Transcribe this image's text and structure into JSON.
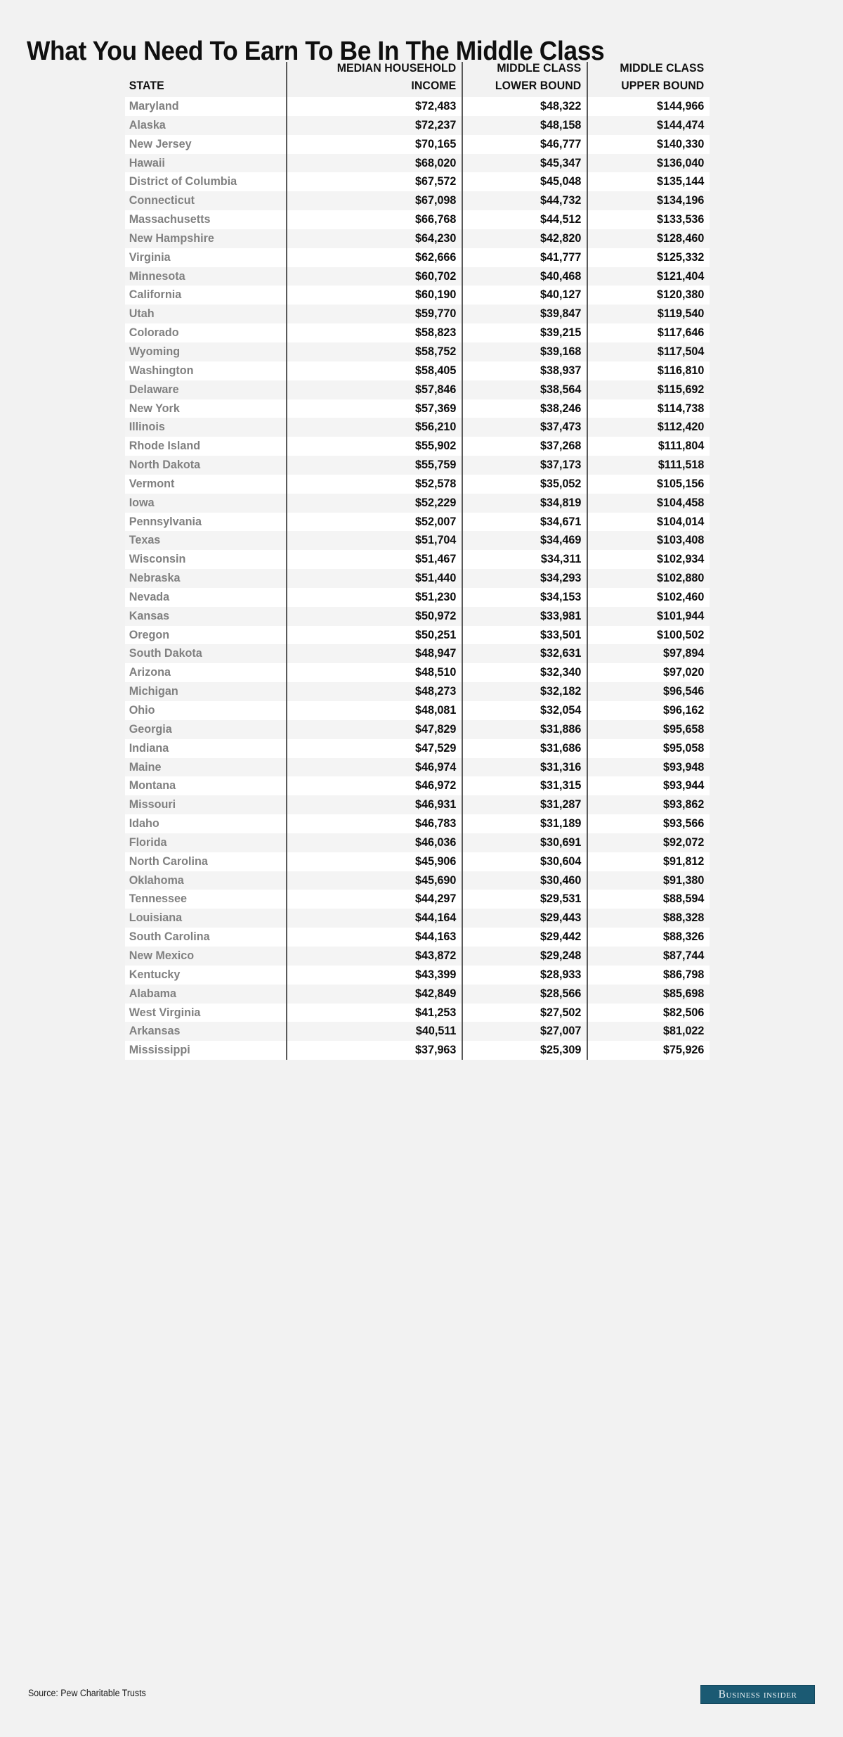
{
  "title": "What You Need To Earn To Be In The Middle Class",
  "table": {
    "headers": {
      "state": "STATE",
      "median_household_income_line1": "MEDIAN HOUSEHOLD",
      "median_household_income_line2": "INCOME",
      "middle_class_lower_line1": "MIDDLE CLASS",
      "middle_class_lower_line2": "LOWER BOUND",
      "middle_class_upper_line1": "MIDDLE CLASS",
      "middle_class_upper_line2": "UPPER BOUND"
    },
    "rows": [
      {
        "state": "Maryland",
        "median_household_income": "$72,483",
        "lower_bound": "$48,322",
        "upper_bound": "$144,966"
      },
      {
        "state": "Alaska",
        "median_household_income": "$72,237",
        "lower_bound": "$48,158",
        "upper_bound": "$144,474"
      },
      {
        "state": "New Jersey",
        "median_household_income": "$70,165",
        "lower_bound": "$46,777",
        "upper_bound": "$140,330"
      },
      {
        "state": "Hawaii",
        "median_household_income": "$68,020",
        "lower_bound": "$45,347",
        "upper_bound": "$136,040"
      },
      {
        "state": "District of Columbia",
        "median_household_income": "$67,572",
        "lower_bound": "$45,048",
        "upper_bound": "$135,144"
      },
      {
        "state": "Connecticut",
        "median_household_income": "$67,098",
        "lower_bound": "$44,732",
        "upper_bound": "$134,196"
      },
      {
        "state": "Massachusetts",
        "median_household_income": "$66,768",
        "lower_bound": "$44,512",
        "upper_bound": "$133,536"
      },
      {
        "state": "New Hampshire",
        "median_household_income": "$64,230",
        "lower_bound": "$42,820",
        "upper_bound": "$128,460"
      },
      {
        "state": "Virginia",
        "median_household_income": "$62,666",
        "lower_bound": "$41,777",
        "upper_bound": "$125,332"
      },
      {
        "state": "Minnesota",
        "median_household_income": "$60,702",
        "lower_bound": "$40,468",
        "upper_bound": "$121,404"
      },
      {
        "state": "California",
        "median_household_income": "$60,190",
        "lower_bound": "$40,127",
        "upper_bound": "$120,380"
      },
      {
        "state": "Utah",
        "median_household_income": "$59,770",
        "lower_bound": "$39,847",
        "upper_bound": "$119,540"
      },
      {
        "state": "Colorado",
        "median_household_income": "$58,823",
        "lower_bound": "$39,215",
        "upper_bound": "$117,646"
      },
      {
        "state": "Wyoming",
        "median_household_income": "$58,752",
        "lower_bound": "$39,168",
        "upper_bound": "$117,504"
      },
      {
        "state": "Washington",
        "median_household_income": "$58,405",
        "lower_bound": "$38,937",
        "upper_bound": "$116,810"
      },
      {
        "state": "Delaware",
        "median_household_income": "$57,846",
        "lower_bound": "$38,564",
        "upper_bound": "$115,692"
      },
      {
        "state": "New York",
        "median_household_income": "$57,369",
        "lower_bound": "$38,246",
        "upper_bound": "$114,738"
      },
      {
        "state": "Illinois",
        "median_household_income": "$56,210",
        "lower_bound": "$37,473",
        "upper_bound": "$112,420"
      },
      {
        "state": "Rhode Island",
        "median_household_income": "$55,902",
        "lower_bound": "$37,268",
        "upper_bound": "$111,804"
      },
      {
        "state": "North Dakota",
        "median_household_income": "$55,759",
        "lower_bound": "$37,173",
        "upper_bound": "$111,518"
      },
      {
        "state": "Vermont",
        "median_household_income": "$52,578",
        "lower_bound": "$35,052",
        "upper_bound": "$105,156"
      },
      {
        "state": "Iowa",
        "median_household_income": "$52,229",
        "lower_bound": "$34,819",
        "upper_bound": "$104,458"
      },
      {
        "state": "Pennsylvania",
        "median_household_income": "$52,007",
        "lower_bound": "$34,671",
        "upper_bound": "$104,014"
      },
      {
        "state": "Texas",
        "median_household_income": "$51,704",
        "lower_bound": "$34,469",
        "upper_bound": "$103,408"
      },
      {
        "state": "Wisconsin",
        "median_household_income": "$51,467",
        "lower_bound": "$34,311",
        "upper_bound": "$102,934"
      },
      {
        "state": "Nebraska",
        "median_household_income": "$51,440",
        "lower_bound": "$34,293",
        "upper_bound": "$102,880"
      },
      {
        "state": "Nevada",
        "median_household_income": "$51,230",
        "lower_bound": "$34,153",
        "upper_bound": "$102,460"
      },
      {
        "state": "Kansas",
        "median_household_income": "$50,972",
        "lower_bound": "$33,981",
        "upper_bound": "$101,944"
      },
      {
        "state": "Oregon",
        "median_household_income": "$50,251",
        "lower_bound": "$33,501",
        "upper_bound": "$100,502"
      },
      {
        "state": "South Dakota",
        "median_household_income": "$48,947",
        "lower_bound": "$32,631",
        "upper_bound": "$97,894"
      },
      {
        "state": "Arizona",
        "median_household_income": "$48,510",
        "lower_bound": "$32,340",
        "upper_bound": "$97,020"
      },
      {
        "state": "Michigan",
        "median_household_income": "$48,273",
        "lower_bound": "$32,182",
        "upper_bound": "$96,546"
      },
      {
        "state": "Ohio",
        "median_household_income": "$48,081",
        "lower_bound": "$32,054",
        "upper_bound": "$96,162"
      },
      {
        "state": "Georgia",
        "median_household_income": "$47,829",
        "lower_bound": "$31,886",
        "upper_bound": "$95,658"
      },
      {
        "state": "Indiana",
        "median_household_income": "$47,529",
        "lower_bound": "$31,686",
        "upper_bound": "$95,058"
      },
      {
        "state": "Maine",
        "median_household_income": "$46,974",
        "lower_bound": "$31,316",
        "upper_bound": "$93,948"
      },
      {
        "state": "Montana",
        "median_household_income": "$46,972",
        "lower_bound": "$31,315",
        "upper_bound": "$93,944"
      },
      {
        "state": "Missouri",
        "median_household_income": "$46,931",
        "lower_bound": "$31,287",
        "upper_bound": "$93,862"
      },
      {
        "state": "Idaho",
        "median_household_income": "$46,783",
        "lower_bound": "$31,189",
        "upper_bound": "$93,566"
      },
      {
        "state": "Florida",
        "median_household_income": "$46,036",
        "lower_bound": "$30,691",
        "upper_bound": "$92,072"
      },
      {
        "state": "North Carolina",
        "median_household_income": "$45,906",
        "lower_bound": "$30,604",
        "upper_bound": "$91,812"
      },
      {
        "state": "Oklahoma",
        "median_household_income": "$45,690",
        "lower_bound": "$30,460",
        "upper_bound": "$91,380"
      },
      {
        "state": "Tennessee",
        "median_household_income": "$44,297",
        "lower_bound": "$29,531",
        "upper_bound": "$88,594"
      },
      {
        "state": "Louisiana",
        "median_household_income": "$44,164",
        "lower_bound": "$29,443",
        "upper_bound": "$88,328"
      },
      {
        "state": "South Carolina",
        "median_household_income": "$44,163",
        "lower_bound": "$29,442",
        "upper_bound": "$88,326"
      },
      {
        "state": "New Mexico",
        "median_household_income": "$43,872",
        "lower_bound": "$29,248",
        "upper_bound": "$87,744"
      },
      {
        "state": "Kentucky",
        "median_household_income": "$43,399",
        "lower_bound": "$28,933",
        "upper_bound": "$86,798"
      },
      {
        "state": "Alabama",
        "median_household_income": "$42,849",
        "lower_bound": "$28,566",
        "upper_bound": "$85,698"
      },
      {
        "state": "West Virginia",
        "median_household_income": "$41,253",
        "lower_bound": "$27,502",
        "upper_bound": "$82,506"
      },
      {
        "state": "Arkansas",
        "median_household_income": "$40,511",
        "lower_bound": "$27,007",
        "upper_bound": "$81,022"
      },
      {
        "state": "Mississippi",
        "median_household_income": "$37,963",
        "lower_bound": "$25,309",
        "upper_bound": "$75,926"
      }
    ]
  },
  "footer": {
    "source": "Source: Pew Charitable Trusts",
    "logo_text": "Business Insider"
  },
  "colors": {
    "background": "#f2f2f2",
    "title": "#0f0f0f",
    "state_text": "#808080",
    "value_text": "#0d0d0d",
    "divider": "#595959",
    "row_odd": "#ffffff",
    "row_even": "#f4f4f4",
    "logo_background": "#1b5a73",
    "logo_text": "#eef4f7"
  }
}
